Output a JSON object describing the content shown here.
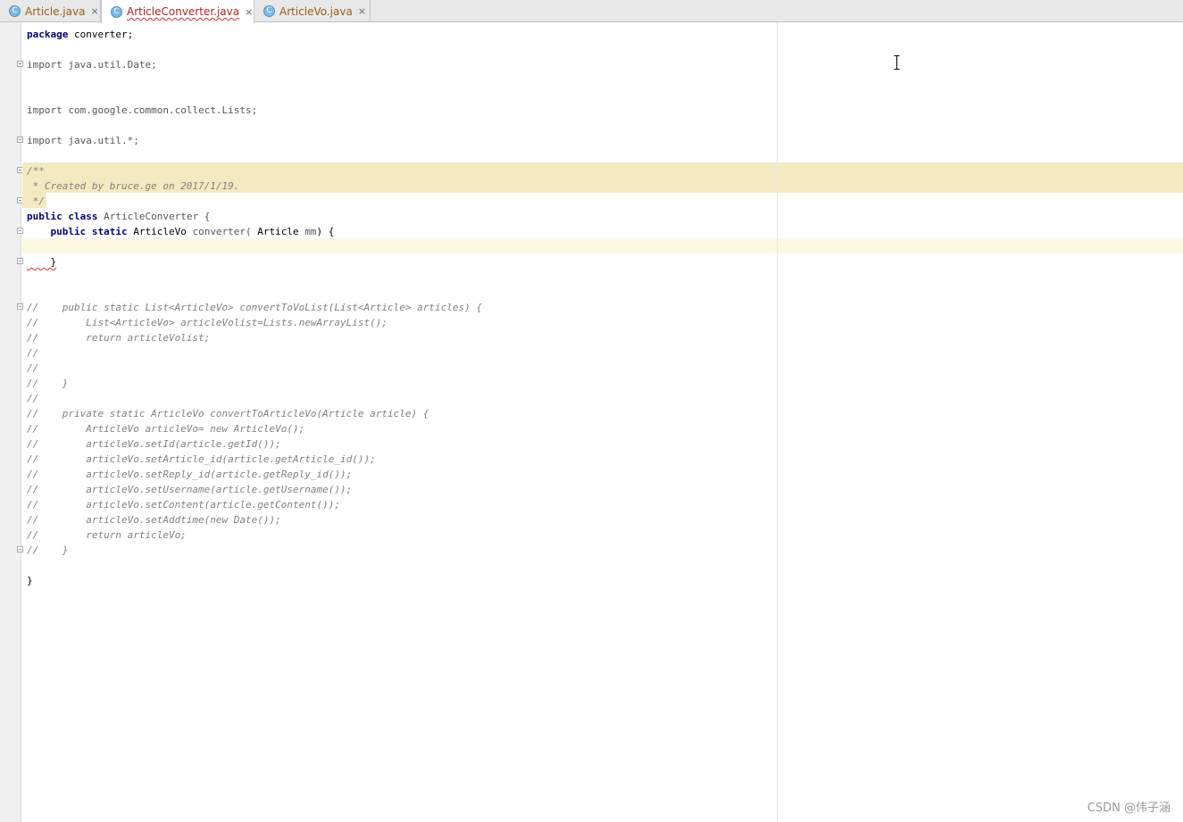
{
  "tabs": [
    {
      "label": "Article.java",
      "close": "×",
      "icon": "class-c-icon",
      "active": false
    },
    {
      "label": "ArticleConverter.java",
      "close": "×",
      "icon": "class-c-icon",
      "active": true
    },
    {
      "label": "ArticleVo.java",
      "close": "×",
      "icon": "class-c-icon",
      "active": false
    }
  ],
  "tab_icon_glyph": "C",
  "code": {
    "l1_kw": "package",
    "l1_rest": " converter;",
    "l3_kw": "import",
    "l3_rest": " java.util.Date;",
    "l6_kw": "import",
    "l6_rest": " com.google.common.collect.Lists;",
    "l8_kw": "import",
    "l8_rest": " java.util.*;",
    "c1": "/**",
    "c2": " * Created by bruce.ge on 2017/1/19.",
    "c3": " */",
    "cls_kw": "public class",
    "cls_name": " ArticleConverter {",
    "m_kw": "    public static",
    "m_type": " ArticleVo",
    "m_name": " converter(",
    "m_ptype": " Article",
    "m_param": " mm",
    "m_end": ") {",
    "close_brace_indent": "    }",
    "comment_lines": [
      "//    public static List<ArticleVo> convertToVoList(List<Article> articles) {",
      "//        List<ArticleVo> articleVolist=Lists.newArrayList();",
      "//        return articleVolist;",
      "//",
      "//",
      "//    }",
      "//",
      "//    private static ArticleVo convertToArticleVo(Article article) {",
      "//        ArticleVo articleVo= new ArticleVo();",
      "//        articleVo.setId(article.getId());",
      "//        articleVo.setArticle_id(article.getArticle_id());",
      "//        articleVo.setReply_id(article.getReply_id());",
      "//        articleVo.setUsername(article.getUsername());",
      "//        articleVo.setContent(article.getContent());",
      "//        articleVo.setAddtime(new Date());",
      "//        return articleVo;",
      "//    }"
    ],
    "final_brace": "}"
  },
  "watermark": "CSDN @伟子涵",
  "colors": {
    "keyword": "#000080",
    "comment": "#808080",
    "comment_highlight": "#f5e9bf",
    "caret_row": "#fdf8e1",
    "active_tab_text": "#b0231a"
  }
}
